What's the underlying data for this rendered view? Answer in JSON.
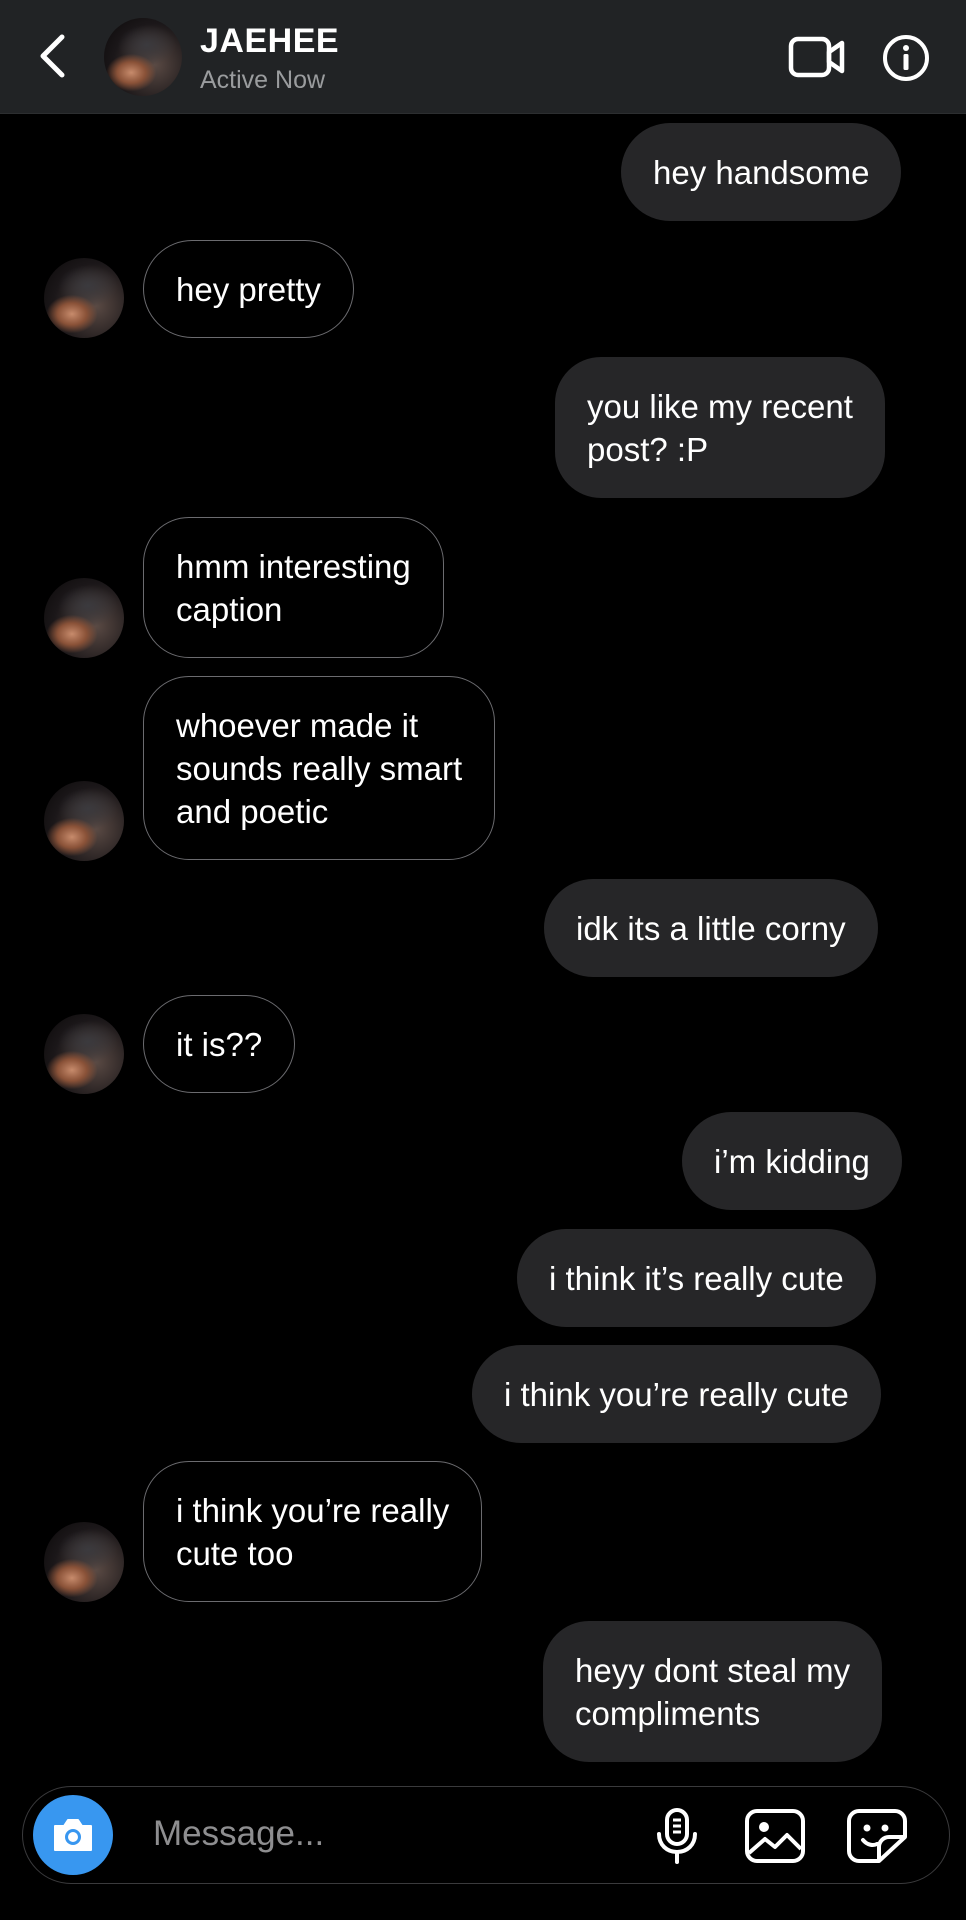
{
  "header": {
    "title": "JAEHEE",
    "status": "Active Now"
  },
  "messages": [
    {
      "from": "me",
      "text": "hey handsome"
    },
    {
      "from": "them",
      "text": "hey pretty"
    },
    {
      "from": "me",
      "text": "you like my recent\npost? :P"
    },
    {
      "from": "them",
      "text": "hmm interesting\ncaption"
    },
    {
      "from": "them",
      "text": "whoever made it\nsounds really smart\nand poetic"
    },
    {
      "from": "me",
      "text": "idk its a little corny"
    },
    {
      "from": "them",
      "text": "it is??"
    },
    {
      "from": "me",
      "text": "i’m kidding"
    },
    {
      "from": "me",
      "text": "i think it’s really cute"
    },
    {
      "from": "me",
      "text": "i think you’re really cute"
    },
    {
      "from": "them",
      "text": "i think you’re really\ncute too"
    },
    {
      "from": "me",
      "text": "heyy dont steal my\ncompliments"
    }
  ],
  "composer": {
    "placeholder": "Message..."
  },
  "icons": {
    "back": "chevron-left-icon",
    "video": "video-camera-icon",
    "info": "info-icon",
    "camera": "camera-icon",
    "mic": "microphone-icon",
    "gallery": "image-icon",
    "sticker": "sticker-icon"
  },
  "colors": {
    "header_bg": "#212325",
    "sent_bubble": "#262628",
    "camera_button": "#3897f0"
  }
}
